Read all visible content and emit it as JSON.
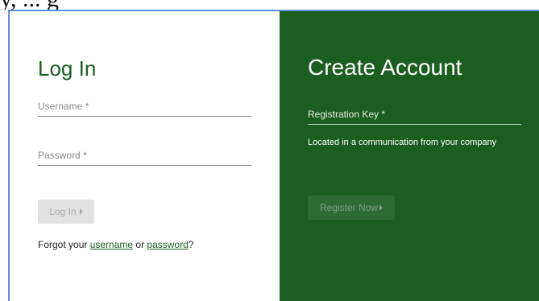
{
  "top_strip": {
    "text": "y, ... g"
  },
  "login": {
    "title": "Log In",
    "username_placeholder": "Username *",
    "password_placeholder": "Password *",
    "button_label": "Log In",
    "forgot": {
      "prefix": "Forgot your ",
      "username_link": "username",
      "middle": " or ",
      "password_link": "password",
      "suffix": "?"
    }
  },
  "register": {
    "title": "Create Account",
    "key_placeholder": "Registration Key *",
    "help_text": "Located in a communication from your company",
    "button_label": "Register Now"
  },
  "colors": {
    "brand_green": "#1b5e20",
    "window_border": "#5d8fd6"
  }
}
